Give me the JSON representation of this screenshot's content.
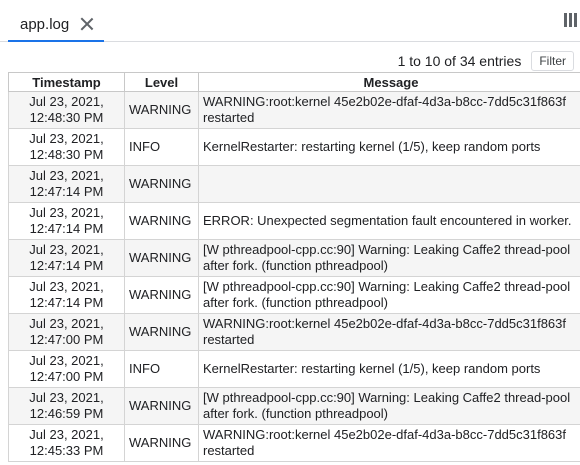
{
  "tab": {
    "label": "app.log"
  },
  "pager": {
    "range_text": "1 to 10 of 34 entries",
    "filter_label": "Filter"
  },
  "table": {
    "headers": [
      "Timestamp",
      "Level",
      "Message"
    ],
    "rows": [
      {
        "date": "Jul 23, 2021,",
        "time": "12:48:30 PM",
        "level": "WARNING",
        "message": "WARNING:root:kernel 45e2b02e-dfaf-4d3a-b8cc-7dd5c31f863f restarted"
      },
      {
        "date": "Jul 23, 2021,",
        "time": "12:48:30 PM",
        "level": "INFO",
        "message": "KernelRestarter: restarting kernel (1/5), keep random ports"
      },
      {
        "date": "Jul 23, 2021,",
        "time": "12:47:14 PM",
        "level": "WARNING",
        "message": ""
      },
      {
        "date": "Jul 23, 2021,",
        "time": "12:47:14 PM",
        "level": "WARNING",
        "message": "ERROR: Unexpected segmentation fault encountered in worker."
      },
      {
        "date": "Jul 23, 2021,",
        "time": "12:47:14 PM",
        "level": "WARNING",
        "message": "[W pthreadpool-cpp.cc:90] Warning: Leaking Caffe2 thread-pool after fork. (function pthreadpool)"
      },
      {
        "date": "Jul 23, 2021,",
        "time": "12:47:14 PM",
        "level": "WARNING",
        "message": "[W pthreadpool-cpp.cc:90] Warning: Leaking Caffe2 thread-pool after fork. (function pthreadpool)"
      },
      {
        "date": "Jul 23, 2021,",
        "time": "12:47:00 PM",
        "level": "WARNING",
        "message": "WARNING:root:kernel 45e2b02e-dfaf-4d3a-b8cc-7dd5c31f863f restarted"
      },
      {
        "date": "Jul 23, 2021,",
        "time": "12:47:00 PM",
        "level": "INFO",
        "message": "KernelRestarter: restarting kernel (1/5), keep random ports"
      },
      {
        "date": "Jul 23, 2021,",
        "time": "12:46:59 PM",
        "level": "WARNING",
        "message": "[W pthreadpool-cpp.cc:90] Warning: Leaking Caffe2 thread-pool after fork. (function pthreadpool)"
      },
      {
        "date": "Jul 23, 2021,",
        "time": "12:45:33 PM",
        "level": "WARNING",
        "message": "WARNING:root:kernel 45e2b02e-dfaf-4d3a-b8cc-7dd5c31f863f restarted"
      }
    ]
  }
}
